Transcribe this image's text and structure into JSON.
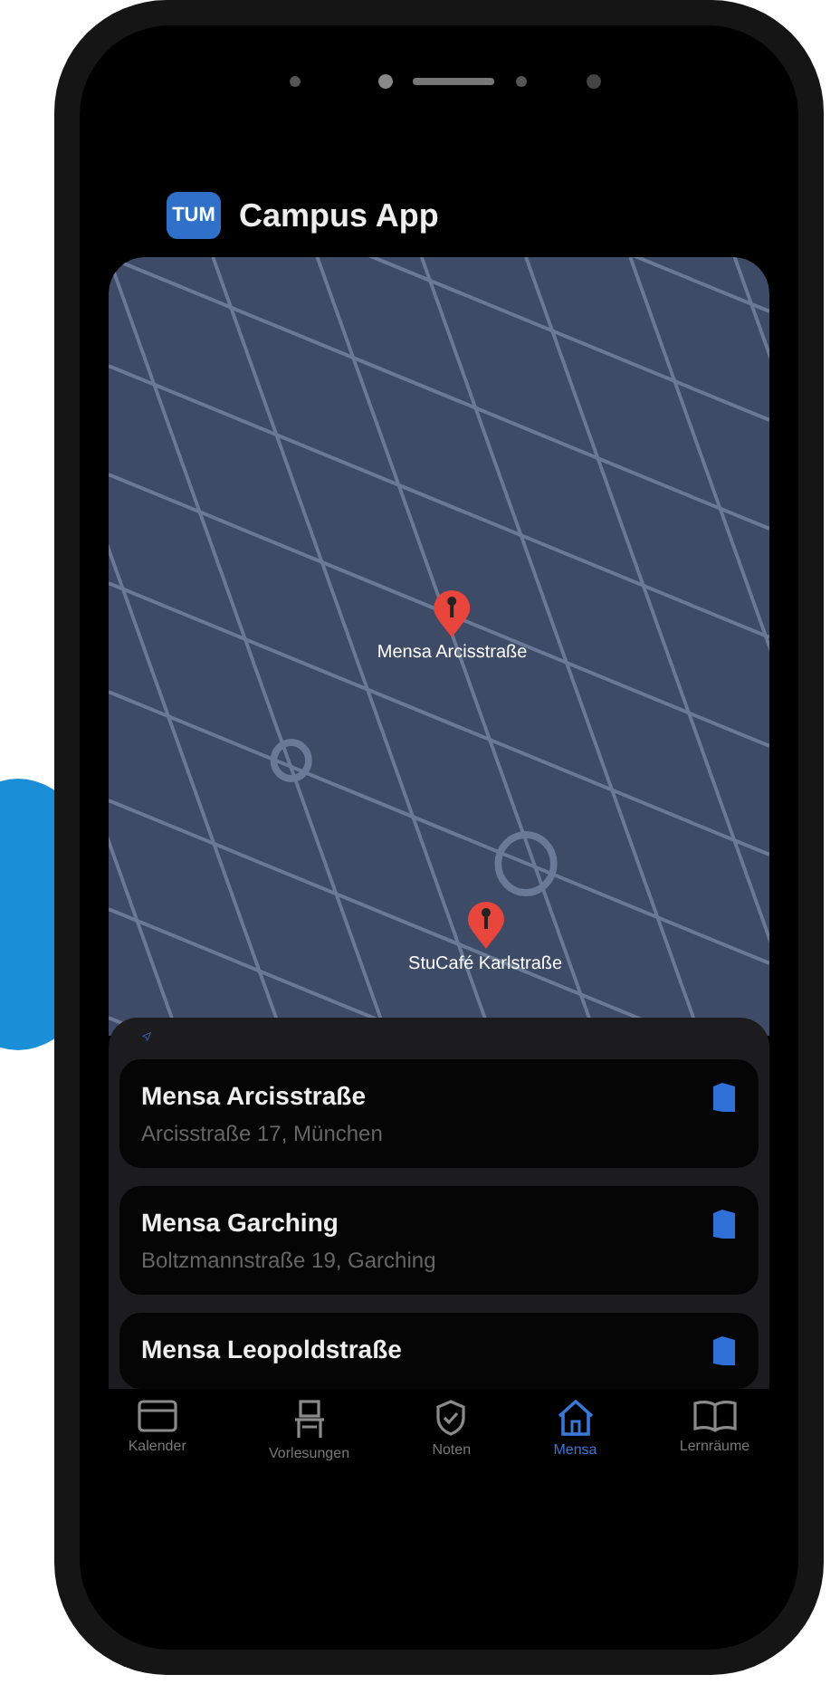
{
  "app_header": {
    "logo": "TUM",
    "title": "Campus App"
  },
  "map": {
    "pins": [
      {
        "label": "Mensa Arcisstraße"
      },
      {
        "label": "StuCafé Karlstraße"
      }
    ]
  },
  "cafeterias": [
    {
      "name": "Mensa Arcisstraße",
      "address": "Arcisstraße 17, München"
    },
    {
      "name": "Mensa Garching",
      "address": "Boltzmannstraße 19, Garching"
    },
    {
      "name": "Mensa Leopoldstraße"
    }
  ],
  "tab_bar": [
    {
      "label": "Kalender",
      "kind": "calendar",
      "selected": false
    },
    {
      "label": "Vorlesungen",
      "kind": "lectures",
      "selected": false
    },
    {
      "label": "Noten",
      "kind": "grades",
      "selected": false
    },
    {
      "label": "Mensa",
      "kind": "home",
      "selected": true
    },
    {
      "label": "Lernräume",
      "kind": "book",
      "selected": false
    }
  ]
}
